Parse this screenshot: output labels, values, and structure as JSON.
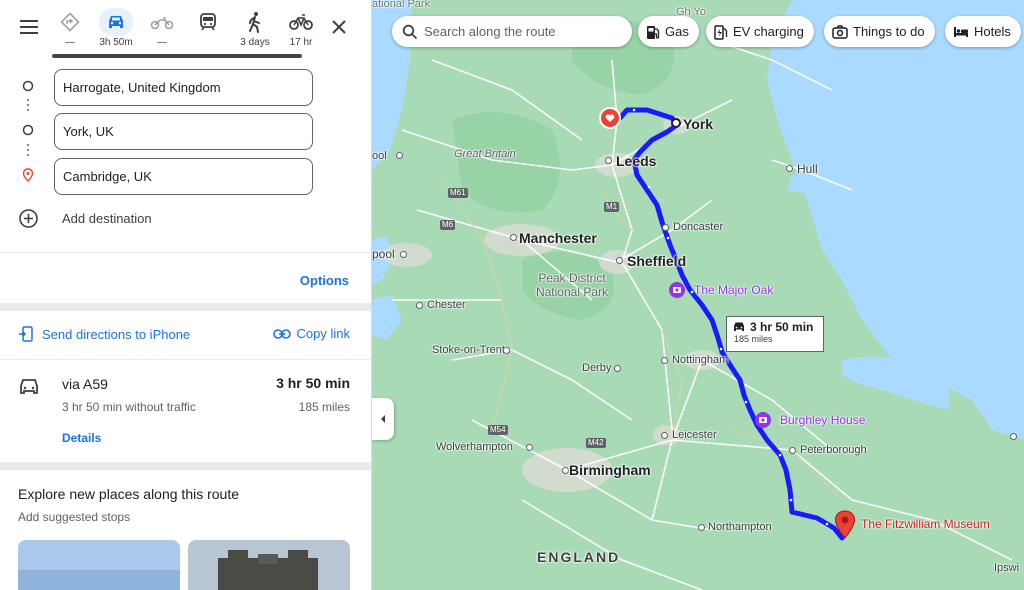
{
  "travel_modes": [
    {
      "name": "best",
      "label": "—",
      "icon": "diamond-turn-icon"
    },
    {
      "name": "driving",
      "label": "3h 50m",
      "icon": "car-icon",
      "active": true
    },
    {
      "name": "motorcycle",
      "label": "—",
      "icon": "motorcycle-icon"
    },
    {
      "name": "transit",
      "label": "",
      "icon": "train-icon"
    },
    {
      "name": "walking",
      "label": "3 days",
      "icon": "walking-icon"
    },
    {
      "name": "cycling",
      "label": "17 hr",
      "icon": "bicycle-icon"
    }
  ],
  "stops": [
    {
      "value": "Harrogate, United Kingdom"
    },
    {
      "value": "York, UK"
    },
    {
      "value": "Cambridge, UK"
    }
  ],
  "add_destination": "Add destination",
  "options_label": "Options",
  "send_directions": "Send directions to iPhone",
  "copy_link": "Copy link",
  "route": {
    "via": "via A59",
    "time": "3 hr 50 min",
    "traffic_note": "3 hr 50 min without traffic",
    "distance": "185 miles",
    "details": "Details"
  },
  "explore": {
    "title": "Explore new places along this route",
    "subtitle": "Add suggested stops"
  },
  "map": {
    "search_placeholder": "Search along the route",
    "chips": [
      "Gas",
      "EV charging",
      "Things to do",
      "Hotels"
    ],
    "callout": {
      "time": "3 hr 50 min",
      "distance": "185 miles"
    },
    "labels": {
      "york": "York",
      "leeds": "Leeds",
      "hull": "Hull",
      "great_britain": "Great Britain",
      "manchester": "Manchester",
      "doncaster": "Doncaster",
      "sheffield": "Sheffield",
      "peak_district": "Peak District National Park",
      "major_oak": "The Major Oak",
      "chester": "Chester",
      "stoke": "Stoke-on-Trent",
      "derby": "Derby",
      "nottingham": "Nottingham",
      "burghley": "Burghley House",
      "leicester": "Leicester",
      "wolverhampton": "Wolverhampton",
      "peterborough": "Peterborough",
      "birmingham": "Birmingham",
      "northampton": "Northampton",
      "fitzwilliam": "The Fitzwilliam Museum",
      "england": "ENGLAND",
      "blackpool_frag": "ool",
      "liverpool_frag": "pool",
      "ipswich_frag": "Ipswi",
      "national_park_frag": "National Park",
      "top_frag1": "ational Park",
      "top_frag2": "Gh Yo",
      "m61": "M61",
      "m6": "M6",
      "m1": "M1",
      "m54": "M54",
      "m42": "M42"
    }
  },
  "colors": {
    "accent": "#1a73e8",
    "route": "#1a1aff",
    "land": "#a8dab5",
    "water": "#aadaff",
    "poi": "#9334e6",
    "pin": "#ea4335"
  }
}
